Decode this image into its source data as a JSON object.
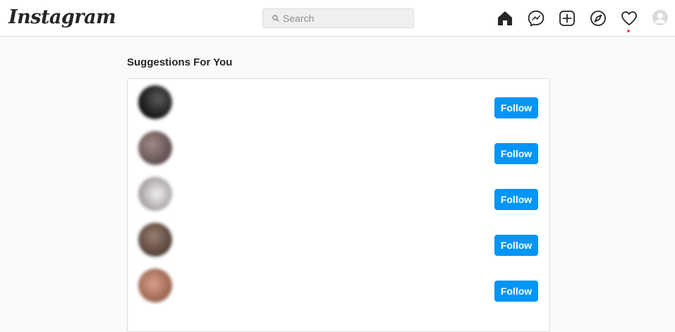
{
  "header": {
    "logo": "Instagram",
    "search": {
      "placeholder": "Search",
      "value": ""
    },
    "nav": [
      {
        "name": "home-icon"
      },
      {
        "name": "messenger-icon"
      },
      {
        "name": "new-post-icon"
      },
      {
        "name": "explore-icon"
      },
      {
        "name": "activity-heart-icon",
        "has_notification": true
      },
      {
        "name": "profile-avatar"
      }
    ]
  },
  "suggestions": {
    "title": "Suggestions For You",
    "items": [
      {
        "follow_label": "Follow",
        "avatar_colors": [
          "#5a5a5a",
          "#0e0e0e"
        ]
      },
      {
        "follow_label": "Follow",
        "avatar_colors": [
          "#a08a87",
          "#5a4a4c"
        ]
      },
      {
        "follow_label": "Follow",
        "avatar_colors": [
          "#f2f0f0",
          "#9a9494"
        ]
      },
      {
        "follow_label": "Follow",
        "avatar_colors": [
          "#9a8070",
          "#4d3c34"
        ]
      },
      {
        "follow_label": "Follow",
        "avatar_colors": [
          "#d9a08a",
          "#8d5a45"
        ]
      }
    ]
  },
  "colors": {
    "primary_button": "#0095f6",
    "notification_dot": "#ed4956",
    "border": "#dbdbdb",
    "background": "#fafafa"
  }
}
